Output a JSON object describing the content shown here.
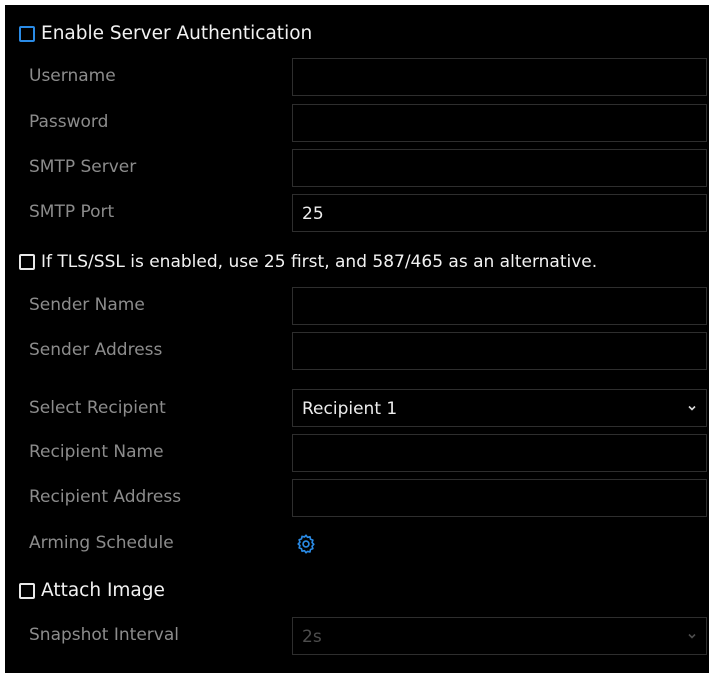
{
  "enable_server_auth": {
    "label": "Enable Server Authentication",
    "checked": false,
    "accent_color": "#2a8be6"
  },
  "username": {
    "label": "Username",
    "value": ""
  },
  "password": {
    "label": "Password",
    "value": ""
  },
  "smtp_server": {
    "label": "SMTP Server",
    "value": ""
  },
  "smtp_port": {
    "label": "SMTP Port",
    "value": "25"
  },
  "tls_ssl": {
    "label": "If TLS/SSL is enabled, use 25 first, and 587/465 as an alternative.",
    "checked": false
  },
  "sender_name": {
    "label": "Sender Name",
    "value": ""
  },
  "sender_address": {
    "label": "Sender Address",
    "value": ""
  },
  "select_recipient": {
    "label": "Select Recipient",
    "value": "Recipient 1",
    "icon": "chevron-down-icon"
  },
  "recipient_name": {
    "label": "Recipient Name",
    "value": ""
  },
  "recipient_address": {
    "label": "Recipient Address",
    "value": ""
  },
  "arming_schedule": {
    "label": "Arming Schedule",
    "icon": "gear-icon",
    "icon_color": "#2a8be6"
  },
  "attach_image": {
    "label": "Attach Image",
    "checked": false
  },
  "snapshot_interval": {
    "label": "Snapshot Interval",
    "value": "2s",
    "disabled": true,
    "icon": "chevron-down-icon"
  }
}
